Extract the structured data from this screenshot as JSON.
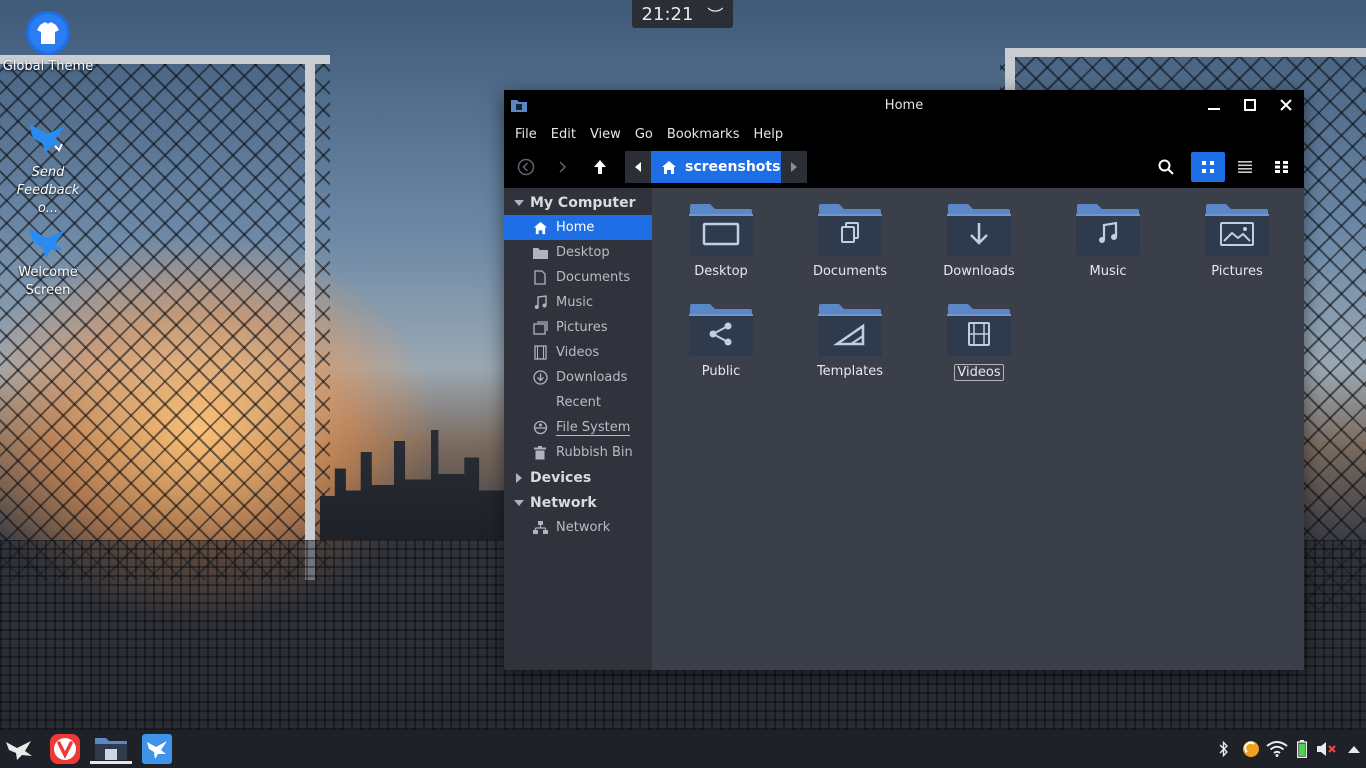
{
  "clock": {
    "time": "21:21",
    "chevron": "︶"
  },
  "desktop": {
    "icons": [
      {
        "label": "Global Theme",
        "icon": "tshirt-icon"
      },
      {
        "label": "Send Feedback o...",
        "icon": "bird-icon"
      },
      {
        "label": "Welcome Screen",
        "icon": "bird-icon"
      }
    ]
  },
  "window": {
    "title": "Home",
    "menu": [
      "File",
      "Edit",
      "View",
      "Go",
      "Bookmarks",
      "Help"
    ],
    "breadcrumb": {
      "current": "screenshots"
    },
    "sidebar": {
      "sections": [
        {
          "title": "My Computer",
          "expanded": true,
          "items": [
            {
              "label": "Home",
              "icon": "home-icon",
              "active": true
            },
            {
              "label": "Desktop",
              "icon": "folder-icon"
            },
            {
              "label": "Documents",
              "icon": "document-icon"
            },
            {
              "label": "Music",
              "icon": "music-icon"
            },
            {
              "label": "Pictures",
              "icon": "pictures-icon"
            },
            {
              "label": "Videos",
              "icon": "videos-icon"
            },
            {
              "label": "Downloads",
              "icon": "download-icon"
            },
            {
              "label": "Recent",
              "icon": "clock-icon"
            },
            {
              "label": "File System",
              "icon": "drive-icon"
            },
            {
              "label": "Rubbish Bin",
              "icon": "trash-icon"
            }
          ]
        },
        {
          "title": "Devices",
          "expanded": false,
          "items": []
        },
        {
          "title": "Network",
          "expanded": true,
          "items": [
            {
              "label": "Network",
              "icon": "network-icon"
            }
          ]
        }
      ]
    },
    "folders": [
      {
        "label": "Desktop",
        "icon": "monitor-icon"
      },
      {
        "label": "Documents",
        "icon": "copy-icon"
      },
      {
        "label": "Downloads",
        "icon": "arrow-down-icon"
      },
      {
        "label": "Music",
        "icon": "music-icon"
      },
      {
        "label": "Pictures",
        "icon": "image-icon"
      },
      {
        "label": "Public",
        "icon": "share-icon"
      },
      {
        "label": "Templates",
        "icon": "template-icon"
      },
      {
        "label": "Videos",
        "icon": "film-icon",
        "selected": true
      }
    ]
  },
  "colors": {
    "accent": "#1e6fe6",
    "window_bg": "#3b3f4a",
    "sidebar_bg": "#30333b",
    "folder": "#5b87c6",
    "folder_front": "#2f3a4d"
  }
}
